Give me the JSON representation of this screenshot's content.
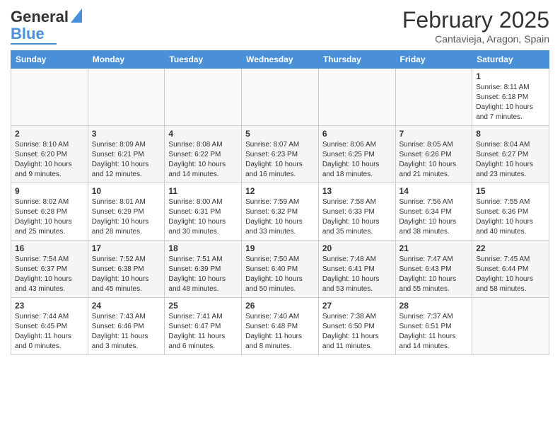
{
  "header": {
    "logo_line1": "General",
    "logo_line2": "Blue",
    "main_title": "February 2025",
    "subtitle": "Cantavieja, Aragon, Spain"
  },
  "calendar": {
    "days_of_week": [
      "Sunday",
      "Monday",
      "Tuesday",
      "Wednesday",
      "Thursday",
      "Friday",
      "Saturday"
    ],
    "weeks": [
      [
        {
          "day": "",
          "info": ""
        },
        {
          "day": "",
          "info": ""
        },
        {
          "day": "",
          "info": ""
        },
        {
          "day": "",
          "info": ""
        },
        {
          "day": "",
          "info": ""
        },
        {
          "day": "",
          "info": ""
        },
        {
          "day": "1",
          "info": "Sunrise: 8:11 AM\nSunset: 6:18 PM\nDaylight: 10 hours and 7 minutes."
        }
      ],
      [
        {
          "day": "2",
          "info": "Sunrise: 8:10 AM\nSunset: 6:20 PM\nDaylight: 10 hours and 9 minutes."
        },
        {
          "day": "3",
          "info": "Sunrise: 8:09 AM\nSunset: 6:21 PM\nDaylight: 10 hours and 12 minutes."
        },
        {
          "day": "4",
          "info": "Sunrise: 8:08 AM\nSunset: 6:22 PM\nDaylight: 10 hours and 14 minutes."
        },
        {
          "day": "5",
          "info": "Sunrise: 8:07 AM\nSunset: 6:23 PM\nDaylight: 10 hours and 16 minutes."
        },
        {
          "day": "6",
          "info": "Sunrise: 8:06 AM\nSunset: 6:25 PM\nDaylight: 10 hours and 18 minutes."
        },
        {
          "day": "7",
          "info": "Sunrise: 8:05 AM\nSunset: 6:26 PM\nDaylight: 10 hours and 21 minutes."
        },
        {
          "day": "8",
          "info": "Sunrise: 8:04 AM\nSunset: 6:27 PM\nDaylight: 10 hours and 23 minutes."
        }
      ],
      [
        {
          "day": "9",
          "info": "Sunrise: 8:02 AM\nSunset: 6:28 PM\nDaylight: 10 hours and 25 minutes."
        },
        {
          "day": "10",
          "info": "Sunrise: 8:01 AM\nSunset: 6:29 PM\nDaylight: 10 hours and 28 minutes."
        },
        {
          "day": "11",
          "info": "Sunrise: 8:00 AM\nSunset: 6:31 PM\nDaylight: 10 hours and 30 minutes."
        },
        {
          "day": "12",
          "info": "Sunrise: 7:59 AM\nSunset: 6:32 PM\nDaylight: 10 hours and 33 minutes."
        },
        {
          "day": "13",
          "info": "Sunrise: 7:58 AM\nSunset: 6:33 PM\nDaylight: 10 hours and 35 minutes."
        },
        {
          "day": "14",
          "info": "Sunrise: 7:56 AM\nSunset: 6:34 PM\nDaylight: 10 hours and 38 minutes."
        },
        {
          "day": "15",
          "info": "Sunrise: 7:55 AM\nSunset: 6:36 PM\nDaylight: 10 hours and 40 minutes."
        }
      ],
      [
        {
          "day": "16",
          "info": "Sunrise: 7:54 AM\nSunset: 6:37 PM\nDaylight: 10 hours and 43 minutes."
        },
        {
          "day": "17",
          "info": "Sunrise: 7:52 AM\nSunset: 6:38 PM\nDaylight: 10 hours and 45 minutes."
        },
        {
          "day": "18",
          "info": "Sunrise: 7:51 AM\nSunset: 6:39 PM\nDaylight: 10 hours and 48 minutes."
        },
        {
          "day": "19",
          "info": "Sunrise: 7:50 AM\nSunset: 6:40 PM\nDaylight: 10 hours and 50 minutes."
        },
        {
          "day": "20",
          "info": "Sunrise: 7:48 AM\nSunset: 6:41 PM\nDaylight: 10 hours and 53 minutes."
        },
        {
          "day": "21",
          "info": "Sunrise: 7:47 AM\nSunset: 6:43 PM\nDaylight: 10 hours and 55 minutes."
        },
        {
          "day": "22",
          "info": "Sunrise: 7:45 AM\nSunset: 6:44 PM\nDaylight: 10 hours and 58 minutes."
        }
      ],
      [
        {
          "day": "23",
          "info": "Sunrise: 7:44 AM\nSunset: 6:45 PM\nDaylight: 11 hours and 0 minutes."
        },
        {
          "day": "24",
          "info": "Sunrise: 7:43 AM\nSunset: 6:46 PM\nDaylight: 11 hours and 3 minutes."
        },
        {
          "day": "25",
          "info": "Sunrise: 7:41 AM\nSunset: 6:47 PM\nDaylight: 11 hours and 6 minutes."
        },
        {
          "day": "26",
          "info": "Sunrise: 7:40 AM\nSunset: 6:48 PM\nDaylight: 11 hours and 8 minutes."
        },
        {
          "day": "27",
          "info": "Sunrise: 7:38 AM\nSunset: 6:50 PM\nDaylight: 11 hours and 11 minutes."
        },
        {
          "day": "28",
          "info": "Sunrise: 7:37 AM\nSunset: 6:51 PM\nDaylight: 11 hours and 14 minutes."
        },
        {
          "day": "",
          "info": ""
        }
      ]
    ]
  }
}
